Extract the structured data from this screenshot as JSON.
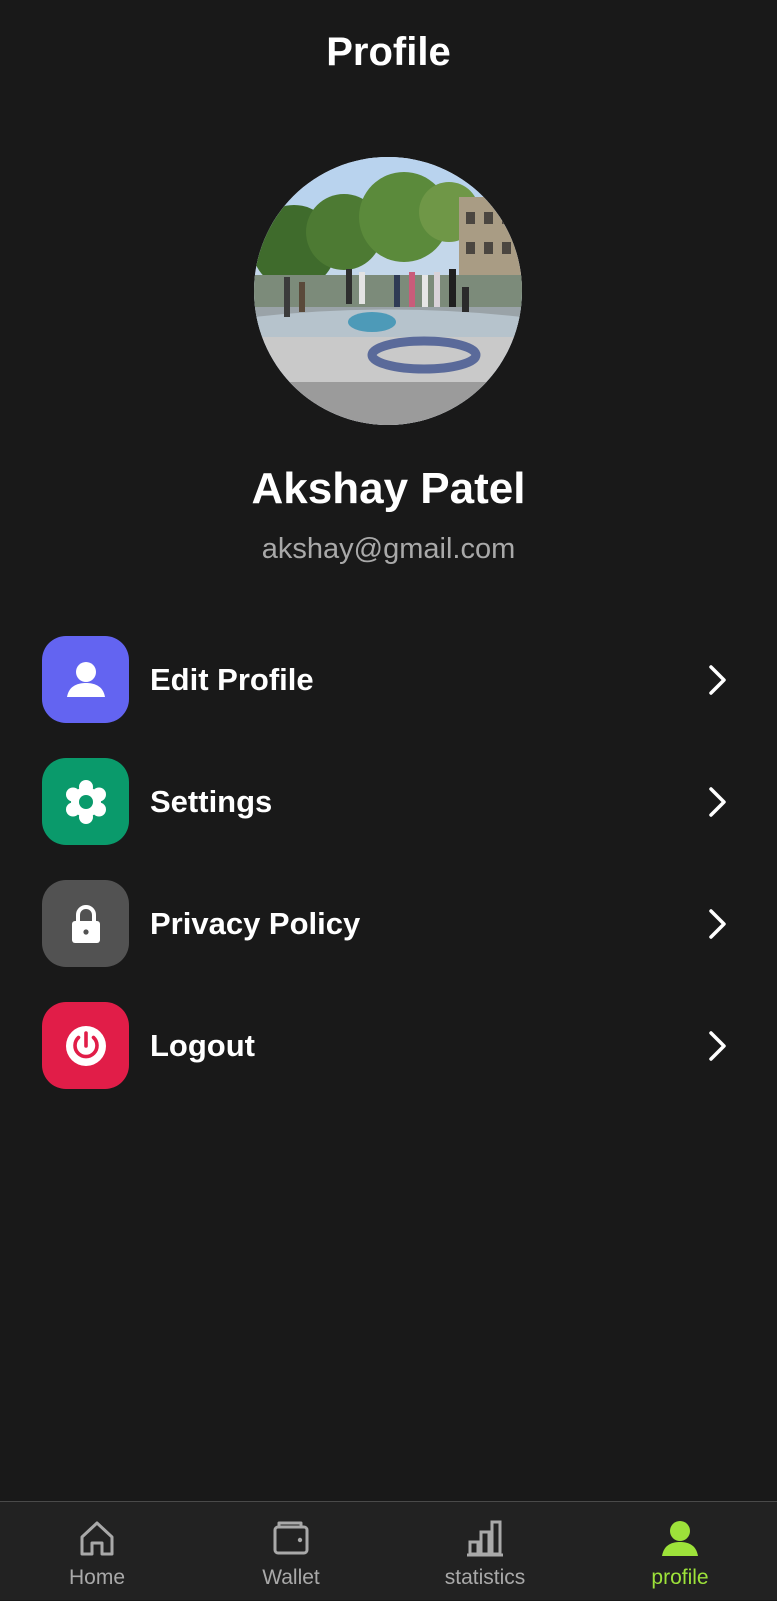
{
  "header": {
    "title": "Profile"
  },
  "profile": {
    "name": "Akshay Patel",
    "email": "akshay@gmail.com"
  },
  "menu": {
    "items": [
      {
        "label": "Edit Profile",
        "icon": "user-icon",
        "color": "#6364f1"
      },
      {
        "label": "Settings",
        "icon": "gear-icon",
        "color": "#0a9a6b"
      },
      {
        "label": "Privacy Policy",
        "icon": "lock-icon",
        "color": "#525252"
      },
      {
        "label": "Logout",
        "icon": "power-icon",
        "color": "#e11d48"
      }
    ]
  },
  "bottom_nav": {
    "items": [
      {
        "label": "Home",
        "icon": "home-icon",
        "active": false
      },
      {
        "label": "Wallet",
        "icon": "wallet-icon",
        "active": false
      },
      {
        "label": "statistics",
        "icon": "bar-chart-icon",
        "active": false
      },
      {
        "label": "profile",
        "icon": "profile-icon",
        "active": true
      }
    ],
    "active_color": "#9de23a",
    "inactive_color": "#a9a9a9"
  }
}
